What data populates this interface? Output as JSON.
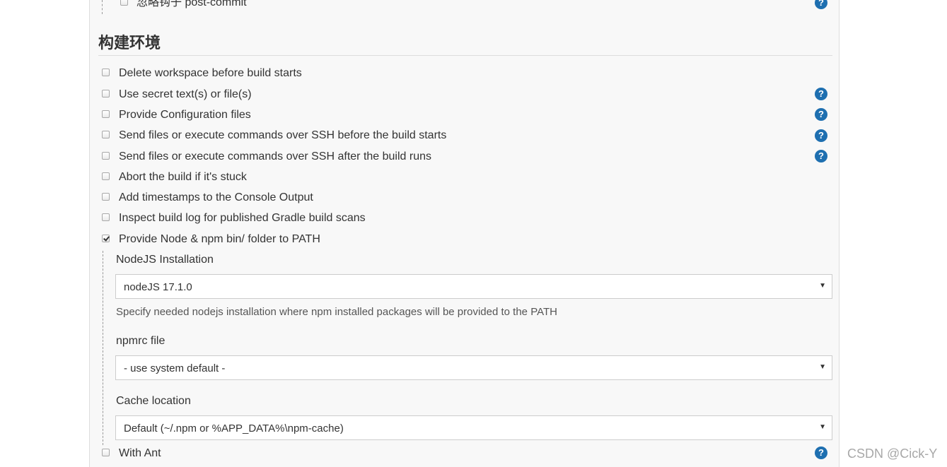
{
  "top_row": {
    "label": "忽略钩子 post-commit",
    "checked": false
  },
  "section": {
    "title": "构建环境"
  },
  "options": [
    {
      "label": "Delete workspace before build starts",
      "checked": false,
      "help": false
    },
    {
      "label": "Use secret text(s) or file(s)",
      "checked": false,
      "help": true
    },
    {
      "label": "Provide Configuration files",
      "checked": false,
      "help": true
    },
    {
      "label": "Send files or execute commands over SSH before the build starts",
      "checked": false,
      "help": true
    },
    {
      "label": "Send files or execute commands over SSH after the build runs",
      "checked": false,
      "help": true
    },
    {
      "label": "Abort the build if it's stuck",
      "checked": false,
      "help": false
    },
    {
      "label": "Add timestamps to the Console Output",
      "checked": false,
      "help": false
    },
    {
      "label": "Inspect build log for published Gradle build scans",
      "checked": false,
      "help": false
    },
    {
      "label": "Provide Node & npm bin/ folder to PATH",
      "checked": true,
      "help": false
    }
  ],
  "node_config": {
    "nodejs_installation": {
      "label": "NodeJS Installation",
      "value": "nodeJS 17.1.0",
      "hint": "Specify needed nodejs installation where npm installed packages will be provided to the PATH"
    },
    "npmrc_file": {
      "label": "npmrc file",
      "value": "- use system default -"
    },
    "cache_location": {
      "label": "Cache location",
      "value": "Default (~/.npm or %APP_DATA%\\npm-cache)"
    }
  },
  "with_ant": {
    "label": "With Ant",
    "checked": false,
    "help": true
  },
  "help_symbol": "?",
  "dropdown_arrow": "▼",
  "watermark": "CSDN @Cick-Y",
  "colors": {
    "help_icon": "#1e6fb0",
    "panel_bg": "#f8f8f8"
  }
}
